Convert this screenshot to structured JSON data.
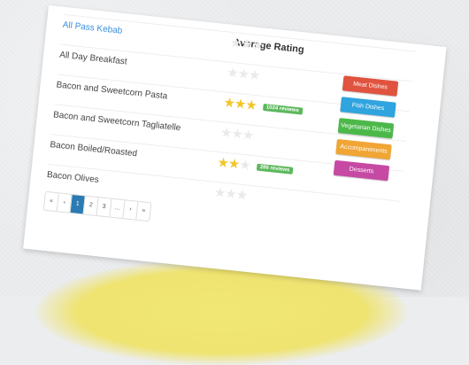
{
  "table": {
    "rating_header": "Average Rating",
    "rows": [
      {
        "name": "All Pass Kebab",
        "rating": 0,
        "max": 3,
        "badge": ""
      },
      {
        "name": "All Day Breakfast",
        "rating": 0,
        "max": 3,
        "badge": ""
      },
      {
        "name": "Bacon and Sweetcorn Pasta",
        "rating": 3,
        "max": 3,
        "badge": "1024 reviews"
      },
      {
        "name": "Bacon and Sweetcorn Tagliatelle",
        "rating": 0,
        "max": 3,
        "badge": ""
      },
      {
        "name": "Bacon Boiled/Roasted",
        "rating": 2,
        "max": 3,
        "badge": "286 reviews"
      },
      {
        "name": "Bacon Olives",
        "rating": 0,
        "max": 3,
        "badge": ""
      }
    ]
  },
  "categories": [
    {
      "label": "Meat Dishes",
      "color": "#e0533f"
    },
    {
      "label": "Fish Dishes",
      "color": "#2fa4de"
    },
    {
      "label": "Vegetarian Dishes",
      "color": "#4cb84a"
    },
    {
      "label": "Accompaniments",
      "color": "#f0a534"
    },
    {
      "label": "Desserts",
      "color": "#c64aa3"
    }
  ],
  "pagination": {
    "items": [
      "«",
      "‹",
      "1",
      "2",
      "3",
      "…",
      "›",
      "»"
    ],
    "active": "1"
  },
  "icons": {
    "rating_star": "star-icon"
  }
}
